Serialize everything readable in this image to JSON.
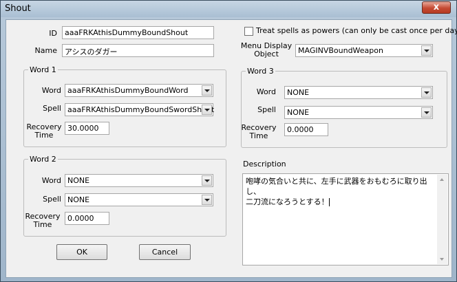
{
  "window": {
    "title": "Shout",
    "close_glyph": "x"
  },
  "form": {
    "id_label": "ID",
    "id_value": "aaaFRKAthisDummyBoundShout",
    "name_label": "Name",
    "name_value": "アシスのダガー",
    "treat_spells_label": "Treat spells as powers (can only be cast once per day)",
    "treat_spells_checked": false,
    "menu_display_label": "Menu Display Object",
    "menu_display_value": "MAGINVBoundWeapon"
  },
  "word1": {
    "title": "Word 1",
    "word_label": "Word",
    "word_value": "aaaFRKAthisDummyBoundWord",
    "spell_label": "Spell",
    "spell_value": "aaaFRKAthisDummyBoundSwordShout",
    "recovery_label": "Recovery Time",
    "recovery_value": "30.0000"
  },
  "word2": {
    "title": "Word 2",
    "word_label": "Word",
    "word_value": "NONE",
    "spell_label": "Spell",
    "spell_value": "NONE",
    "recovery_label": "Recovery Time",
    "recovery_value": "0.0000"
  },
  "word3": {
    "title": "Word 3",
    "word_label": "Word",
    "word_value": "NONE",
    "spell_label": "Spell",
    "spell_value": "NONE",
    "recovery_label": "Recovery Time",
    "recovery_value": "0.0000"
  },
  "description": {
    "label": "Description",
    "text": "咆哮の気合いと共に、左手に武器をおもむろに取り出し、\n二刀流になろうとする！"
  },
  "buttons": {
    "ok": "OK",
    "cancel": "Cancel"
  },
  "icons": {
    "close": "close-icon",
    "dropdown": "chevron-down-icon",
    "scroll_up": "arrow-up-icon",
    "scroll_down": "arrow-down-icon"
  }
}
